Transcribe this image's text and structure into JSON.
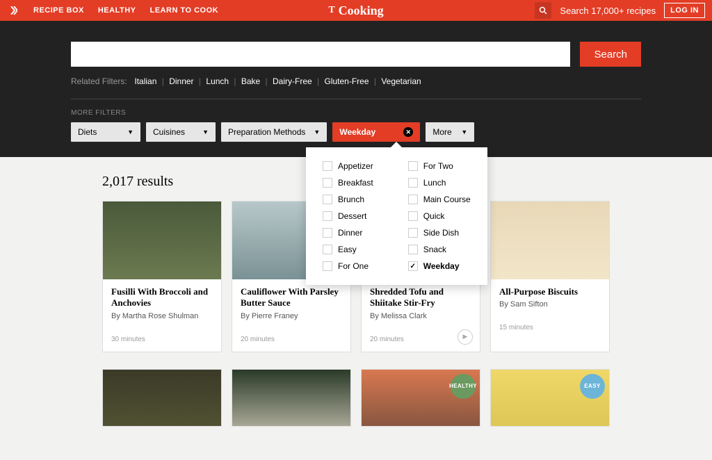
{
  "topbar": {
    "nav": [
      "RECIPE BOX",
      "HEALTHY",
      "LEARN TO COOK"
    ],
    "logo_t": "T",
    "logo": "Cooking",
    "search_placeholder": "Search 17,000+ recipes",
    "login": "LOG IN"
  },
  "search": {
    "button": "Search",
    "related_label": "Related Filters:",
    "related": [
      "Italian",
      "Dinner",
      "Lunch",
      "Bake",
      "Dairy-Free",
      "Gluten-Free",
      "Vegetarian"
    ],
    "more_filters_label": "MORE FILTERS",
    "chips": [
      {
        "label": "Diets",
        "active": false
      },
      {
        "label": "Cuisines",
        "active": false
      },
      {
        "label": "Preparation Methods",
        "active": false
      },
      {
        "label": "Weekday",
        "active": true
      },
      {
        "label": "More",
        "active": false
      }
    ]
  },
  "dropdown": {
    "col1": [
      {
        "label": "Appetizer",
        "checked": false
      },
      {
        "label": "Breakfast",
        "checked": false
      },
      {
        "label": "Brunch",
        "checked": false
      },
      {
        "label": "Dessert",
        "checked": false
      },
      {
        "label": "Dinner",
        "checked": false
      },
      {
        "label": "Easy",
        "checked": false
      },
      {
        "label": "For One",
        "checked": false
      }
    ],
    "col2": [
      {
        "label": "For Two",
        "checked": false
      },
      {
        "label": "Lunch",
        "checked": false
      },
      {
        "label": "Main Course",
        "checked": false
      },
      {
        "label": "Quick",
        "checked": false
      },
      {
        "label": "Side Dish",
        "checked": false
      },
      {
        "label": "Snack",
        "checked": false
      },
      {
        "label": "Weekday",
        "checked": true
      }
    ]
  },
  "results": {
    "count": "2,017 results",
    "cards": [
      {
        "title": "Fusilli With Broccoli and Anchovies",
        "author": "By Martha Rose Shulman",
        "time": "30 minutes",
        "img": "img-fusilli"
      },
      {
        "title": "Cauliflower With Parsley Butter Sauce",
        "author": "By Pierre Franey",
        "time": "20 minutes",
        "img": "img-cauli"
      },
      {
        "title": "Shredded Tofu and Shiitake Stir-Fry",
        "author": "By Melissa Clark",
        "time": "20 minutes",
        "img": "img-tofu",
        "play": true
      },
      {
        "title": "All-Purpose Biscuits",
        "author": "By Sam Sifton",
        "time": "15 minutes",
        "img": "img-biscuit"
      }
    ],
    "row2": [
      {
        "img": "img-r2a"
      },
      {
        "img": "img-r2b"
      },
      {
        "img": "img-r2c",
        "badge": "HEALTHY",
        "badge_class": "healthy"
      },
      {
        "img": "img-r2d",
        "badge": "EASY",
        "badge_class": "easy"
      }
    ]
  }
}
